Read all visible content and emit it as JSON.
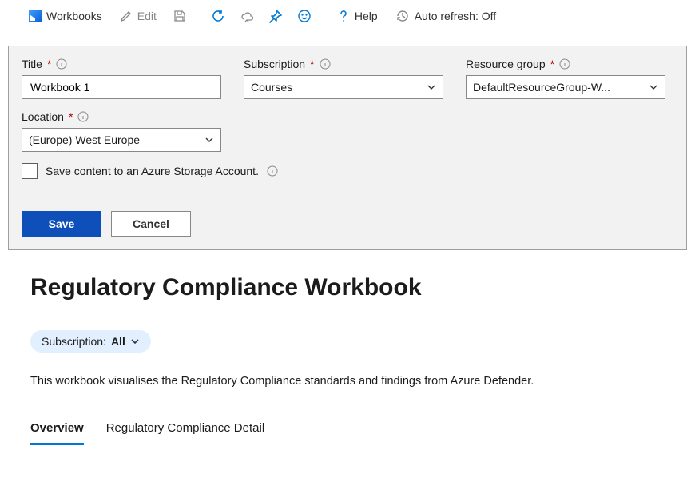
{
  "toolbar": {
    "workbooks_label": "Workbooks",
    "edit_label": "Edit",
    "help_label": "Help",
    "auto_refresh_label": "Auto refresh: Off"
  },
  "save_dialog": {
    "title_label": "Title",
    "title_value": "Workbook 1",
    "subscription_label": "Subscription",
    "subscription_value": "Courses",
    "resource_group_label": "Resource group",
    "resource_group_value": "DefaultResourceGroup-W...",
    "location_label": "Location",
    "location_value": "(Europe) West Europe",
    "storage_checkbox_label": "Save content to an Azure Storage Account.",
    "storage_checked": false,
    "save_btn": "Save",
    "cancel_btn": "Cancel",
    "required_mark": "*"
  },
  "page": {
    "heading": "Regulatory Compliance Workbook",
    "subscription_pill_label": "Subscription:",
    "subscription_pill_value": "All",
    "description": "This workbook visualises the Regulatory Compliance standards and findings from Azure Defender.",
    "tabs": {
      "overview": "Overview",
      "detail": "Regulatory Compliance Detail"
    }
  }
}
